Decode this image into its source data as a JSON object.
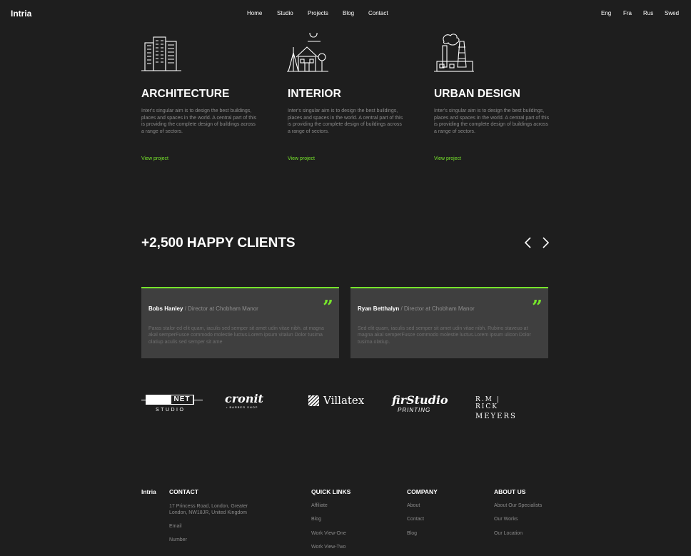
{
  "header": {
    "brand": "Intria",
    "nav": [
      "Home",
      "Studio",
      "Projects",
      "Blog",
      "Contact"
    ],
    "languages": [
      "Eng",
      "Fra",
      "Rus",
      "Swed"
    ]
  },
  "services": [
    {
      "title": "ARCHITECTURE",
      "text": "Inter's singular aim is to design the best buildings, places and spaces in the world. A central part of this is providing the complete design of buildings across a range of sectors.",
      "link": "View project",
      "icon": "buildings-icon"
    },
    {
      "title": "INTERIOR",
      "text": "Inter's singular aim is to design the best buildings, places and spaces in the world. A central part of this is providing the complete design of buildings across a range of sectors.",
      "link": "View project",
      "icon": "house-icon"
    },
    {
      "title": "URBAN DESIGN",
      "text": "Inter's singular aim is to design the best buildings, places and spaces in the world. A central part of this is providing the complete design of buildings across a range of sectors.",
      "link": "View project",
      "icon": "factory-icon"
    }
  ],
  "clients": {
    "title": "+2,500 HAPPY CLIENTS",
    "testimonials": [
      {
        "name": "Bobs Hanley",
        "role": " / Director at Chobham Manor",
        "text": "Paras stalor ed elit quam, iaculis sed semper sit amet udin vitae nibh. at magna akal semperFusce commodo molestie luctus.Lorem ipsum vitalun Dolor tusima olatiup aculis sed semper sit ame"
      },
      {
        "name": "Ryan Betthalyn",
        "role": " / Director at Chobham Manor",
        "text": "Sed elit quam, iaculis sed semper sit amet udin vitae nibh. Rubino staveuo at magna akal semperFusce commodo molestie luctus.Lorem ipsum ulicon Dolor tusima olatiup."
      }
    ]
  },
  "logos": {
    "net": {
      "main": "NET",
      "sub": "STUDIO"
    },
    "cronit": {
      "main": "cronit",
      "sub": "• BARBER SHOP"
    },
    "villatex": "Villatex",
    "fir": {
      "main": "firStudio",
      "sub": "PRINTING"
    },
    "rick": {
      "top": "R.M | RICK",
      "bottom": "MEYERS"
    }
  },
  "footer": {
    "brand": "Intria",
    "contact": {
      "title": "CONTACT",
      "address": "17 Princess Road, London, Greater London, NW18JR, United Kingdom",
      "email": "Email",
      "number": "Number"
    },
    "quick_links": {
      "title": "QUICK LINKS",
      "items": [
        "Affiliate",
        "Blog",
        "Work View-One",
        "Work View-Two"
      ]
    },
    "company": {
      "title": "COMPANY",
      "items": [
        "About",
        "Contact",
        "Blog"
      ]
    },
    "about": {
      "title": "ABOUT US",
      "items": [
        "About Our Specialists",
        "Our Works",
        "Our Location"
      ]
    }
  },
  "colors": {
    "background": "#1e1e1e",
    "accent": "#76e52b",
    "card": "#3f3f3f"
  }
}
